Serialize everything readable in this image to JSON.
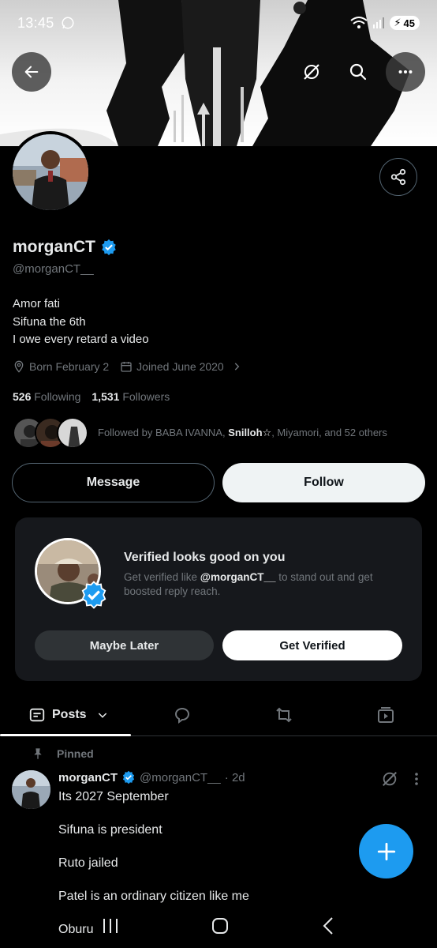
{
  "status": {
    "time": "13:45",
    "battery": "45"
  },
  "profile": {
    "name": "morganCT",
    "handle": "@morganCT__",
    "bio": [
      "Amor fati",
      "Sifuna the 6th",
      "I owe every retard a video"
    ],
    "born": "Born February 2",
    "joined": "Joined June 2020",
    "following_count": "526",
    "following_label": "Following",
    "followers_count": "1,531",
    "followers_label": "Followers",
    "followed_by_prefix": "Followed by BABA IVANNA, ",
    "followed_by_bold": "Snilloh☆",
    "followed_by_suffix": ", Miyamori, and 52 others"
  },
  "actions": {
    "message": "Message",
    "follow": "Follow"
  },
  "verify_card": {
    "title": "Verified looks good on you",
    "desc_prefix": "Get verified like ",
    "desc_handle": "@morganCT__",
    "desc_suffix": " to stand out and get boosted reply reach.",
    "later": "Maybe Later",
    "get": "Get Verified"
  },
  "tabs": {
    "posts": "Posts"
  },
  "post": {
    "pinned_label": "Pinned",
    "name": "morganCT",
    "handle": "@morganCT__",
    "time": "· 2d",
    "lines": [
      "Its 2027 September",
      "Sifuna is president",
      "Ruto jailed",
      "Patel is an ordinary citizen like me",
      "Oburu"
    ]
  },
  "colors": {
    "accent": "#1d9bf0",
    "background": "#000000",
    "muted": "#71767b"
  }
}
